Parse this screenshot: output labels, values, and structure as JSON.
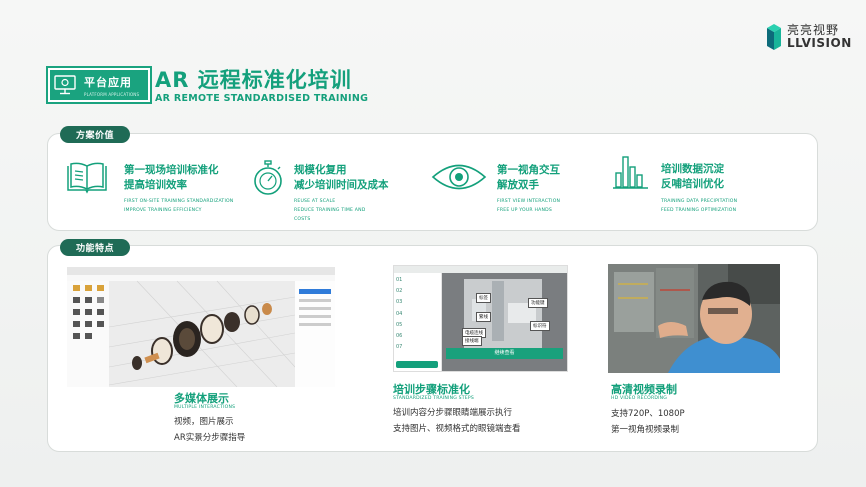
{
  "brand": {
    "cn": "亮亮视野",
    "en": "LLVISION",
    "colors": {
      "primary": "#14a07c",
      "dark": "#1f6b56"
    }
  },
  "header": {
    "badge_cn": "平台应用",
    "badge_en": "PLATFORM APPLICATIONS",
    "title_cn": "AR 远程标准化培训",
    "title_en": "AR REMOTE STANDARDISED TRAINING"
  },
  "value_section": {
    "label": "方案价值",
    "items": [
      {
        "icon": "book-icon",
        "cn1": "第一现场培训标准化",
        "cn2": "提高培训效率",
        "en1": "FIRST ON-SITE TRAINING STANDARDIZATION",
        "en2": "IMPROVE TRAINING EFFICIENCY",
        "en3": ""
      },
      {
        "icon": "stopwatch-icon",
        "cn1": "规模化复用",
        "cn2": "减少培训时间及成本",
        "en1": "REUSE AT SCALE",
        "en2": "REDUCE TRAINING TIME AND",
        "en3": "COSTS"
      },
      {
        "icon": "eye-icon",
        "cn1": "第一视角交互",
        "cn2": "解放双手",
        "en1": "FIRST VIEW INTERACTION",
        "en2": "FREE UP YOUR HANDS",
        "en3": ""
      },
      {
        "icon": "bar-chart-icon",
        "cn1": "培训数据沉淀",
        "cn2": "反哺培训优化",
        "en1": "TRAINING DATA PRECIPITATION",
        "en2": "FEED TRAINING OPTIMIZATION",
        "en3": ""
      }
    ]
  },
  "feature_section": {
    "label": "功能特点",
    "cards": [
      {
        "cn": "多媒体展示",
        "en": "MULTIPLE INTERACTIONS",
        "line1": "视频，图片展示",
        "line2": "AR实景分步骤指导"
      },
      {
        "cn": "培训步骤标准化",
        "en": "STANDARDIZED TRAINING STEPS",
        "line1": "培训内容分步骤眼睛端展示执行",
        "line2": "支持图片、视频格式的眼镜端查看"
      },
      {
        "cn": "高清视频录制",
        "en": "HD VIDEO RECORDING",
        "line1": "支持720P、1080P",
        "line2": "第一视角视频录制"
      }
    ],
    "steps_screen": {
      "steps": [
        "01",
        "02",
        "03",
        "04",
        "05",
        "06",
        "07"
      ],
      "callouts": [
        "标签",
        "功能键",
        "繁线",
        "标识符",
        "电缆连线",
        "接线端"
      ],
      "button": "继续查看"
    }
  }
}
